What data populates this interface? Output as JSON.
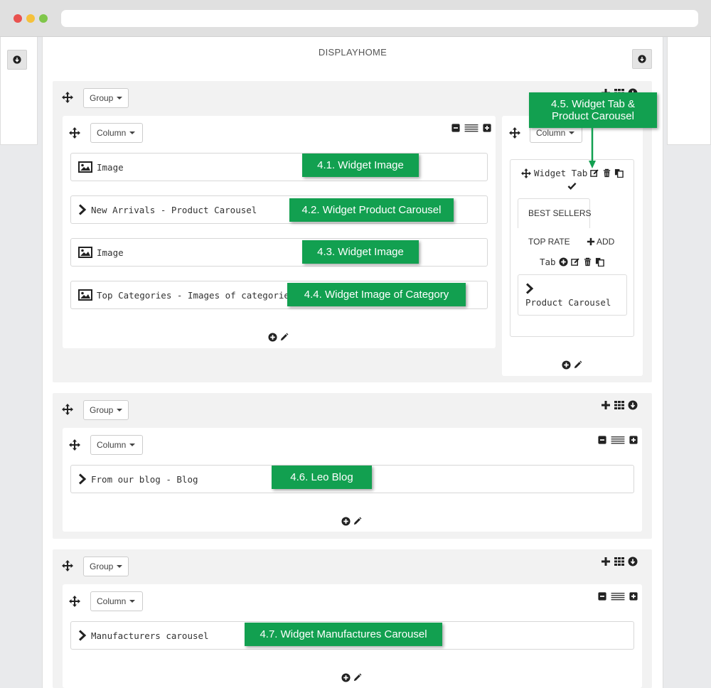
{
  "hook": {
    "title": "DISPLAYHOME"
  },
  "labels": {
    "group": "Group",
    "column": "Column"
  },
  "groups": [
    {
      "columns": [
        {
          "widgets": [
            {
              "label": "Image",
              "icon": "image-icon"
            },
            {
              "label": "New Arrivals - Product Carousel",
              "icon": "chevron-right-icon"
            },
            {
              "label": "Image",
              "icon": "image-icon"
            },
            {
              "label": "Top Categories - Images of categories",
              "icon": "image-icon"
            }
          ]
        },
        {
          "widget_tab": {
            "title": "Widget Tab",
            "tabs": [
              "BEST SELLERS",
              "TOP RATE"
            ],
            "add_label": "ADD",
            "tab_label": "Tab",
            "inner_widget": "Product Carousel"
          }
        }
      ]
    },
    {
      "columns": [
        {
          "widgets": [
            {
              "label": "From our blog - Blog",
              "icon": "chevron-right-icon"
            }
          ]
        }
      ]
    },
    {
      "columns": [
        {
          "widgets": [
            {
              "label": "Manufacturers carousel",
              "icon": "chevron-right-icon"
            }
          ]
        }
      ]
    }
  ],
  "callouts": {
    "c41": "4.1. Widget Image",
    "c42": "4.2. Widget Product Carousel",
    "c43": "4.3. Widget Image",
    "c44": "4.4. Widget Image of Category",
    "c45_line1": "4.5. Widget Tab &",
    "c45_line2": "Product Carousel",
    "c46": "4.6. Leo Blog",
    "c47": "4.7. Widget Manufactures Carousel"
  },
  "colors": {
    "callout": "#12a050",
    "group_bg": "#f2f2f2",
    "page_bg": "#e9eaec"
  }
}
